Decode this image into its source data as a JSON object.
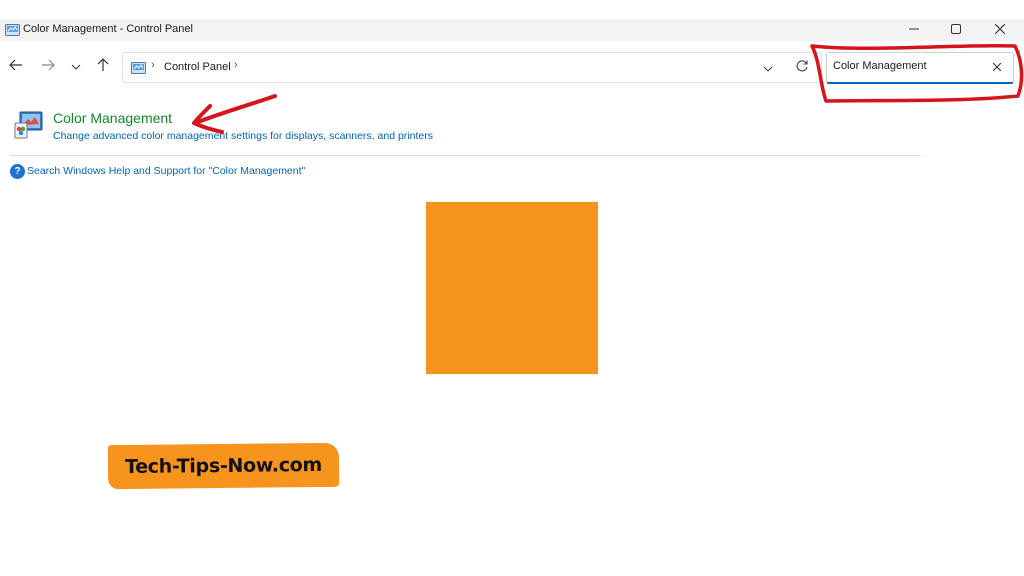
{
  "window": {
    "title": "Color Management - Control Panel",
    "controls": [
      "minimize-icon",
      "maximize-icon",
      "close-icon"
    ]
  },
  "navigation": {
    "icons": [
      "back-arrow-icon",
      "forward-arrow-icon",
      "recent-dropdown-icon",
      "up-arrow-icon"
    ],
    "breadcrumb": [
      "Control Panel"
    ],
    "dropdown_icon": "chevron-down-icon",
    "refresh_icon": "refresh-icon"
  },
  "search": {
    "value": "Color Management",
    "clear_icon": "close-icon"
  },
  "results": [
    {
      "name": "Color Management",
      "description": "Change advanced color management settings for displays, scanners, and printers",
      "icon": "color-management-icon"
    }
  ],
  "help_link": "Search Windows Help and Support for \"Color Management\"",
  "overlay": {
    "brand_text": "Tech-Tips-Now.com",
    "annotation_color": "#d7141c",
    "brand_color": "#f7941d",
    "square_color": "#f7941d"
  }
}
